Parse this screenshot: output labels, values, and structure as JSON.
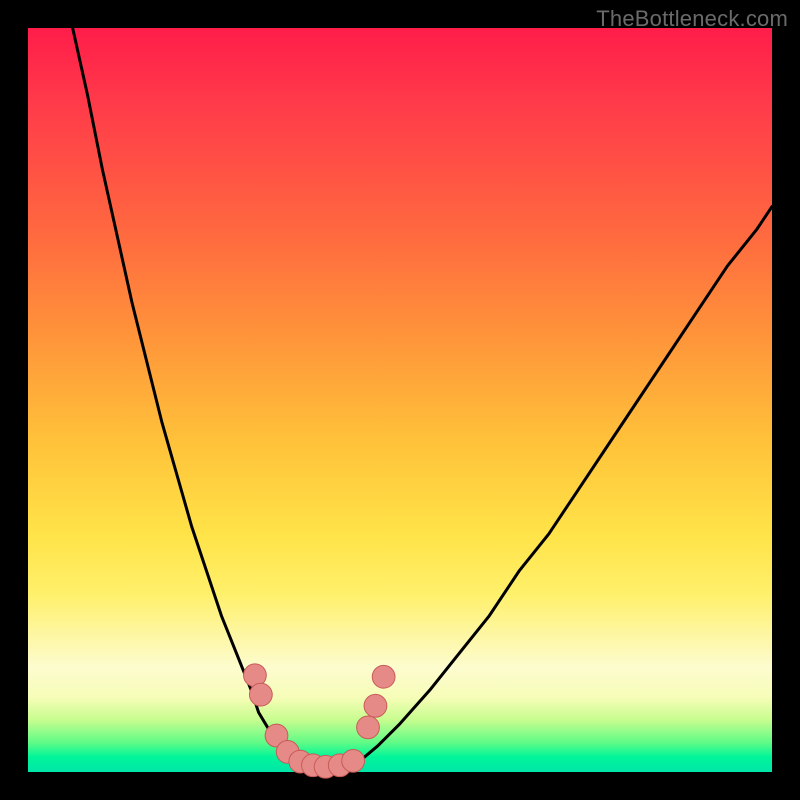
{
  "watermark": "TheBottleneck.com",
  "colors": {
    "frame": "#000000",
    "gradient_top": "#ff1d4a",
    "gradient_mid1": "#ff963a",
    "gradient_mid2": "#ffe348",
    "gradient_bottom": "#00e6a8",
    "curve_stroke": "#000000",
    "marker_fill": "#e68a87",
    "marker_stroke": "#c75b58"
  },
  "chart_data": {
    "type": "line",
    "title": "",
    "xlabel": "",
    "ylabel": "",
    "xlim": [
      0,
      100
    ],
    "ylim": [
      0,
      100
    ],
    "note": "No axis ticks or numeric labels are rendered; values are normalized 0–100 estimates read from pixel positions. y=0 is the bottom green band, y=100 is the top.",
    "series": [
      {
        "name": "left-curve",
        "x": [
          6,
          8,
          10,
          12,
          14,
          16,
          18,
          20,
          22,
          24,
          26,
          28,
          30,
          31,
          32.5,
          34,
          35.5
        ],
        "y": [
          100,
          91,
          81,
          72,
          63,
          55,
          47,
          40,
          33,
          27,
          21,
          16,
          11,
          8,
          5.5,
          3.2,
          1.4
        ]
      },
      {
        "name": "floor-curve",
        "x": [
          35.5,
          37,
          38.5,
          40,
          41.5,
          43,
          44.5
        ],
        "y": [
          1.4,
          0.9,
          0.7,
          0.6,
          0.7,
          0.9,
          1.4
        ]
      },
      {
        "name": "right-curve",
        "x": [
          44.5,
          47,
          50,
          54,
          58,
          62,
          66,
          70,
          74,
          78,
          82,
          86,
          90,
          94,
          98,
          100
        ],
        "y": [
          1.4,
          3.5,
          6.5,
          11,
          16,
          21,
          27,
          32,
          38,
          44,
          50,
          56,
          62,
          68,
          73,
          76
        ]
      }
    ],
    "markers": [
      {
        "x": 30.5,
        "y": 13.0,
        "r": 1.7
      },
      {
        "x": 31.3,
        "y": 10.4,
        "r": 1.7
      },
      {
        "x": 33.4,
        "y": 4.9,
        "r": 1.7
      },
      {
        "x": 34.9,
        "y": 2.7,
        "r": 1.7
      },
      {
        "x": 36.6,
        "y": 1.4,
        "r": 1.7
      },
      {
        "x": 38.3,
        "y": 0.9,
        "r": 1.7
      },
      {
        "x": 40.0,
        "y": 0.7,
        "r": 1.7
      },
      {
        "x": 41.9,
        "y": 0.9,
        "r": 1.7
      },
      {
        "x": 43.7,
        "y": 1.5,
        "r": 1.7
      },
      {
        "x": 45.7,
        "y": 6.0,
        "r": 1.7
      },
      {
        "x": 46.7,
        "y": 8.9,
        "r": 1.7
      },
      {
        "x": 47.8,
        "y": 12.8,
        "r": 1.7
      }
    ]
  }
}
